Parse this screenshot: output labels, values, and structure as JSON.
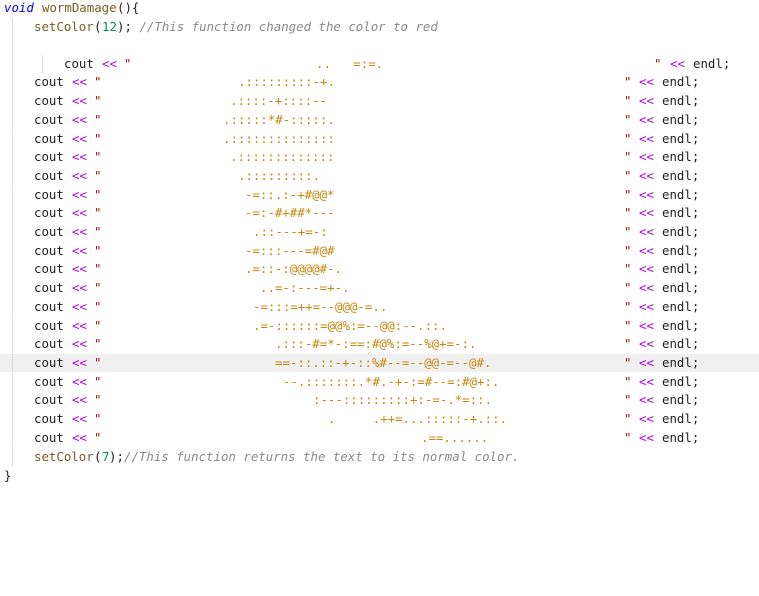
{
  "code": {
    "func_signature": {
      "keyword": "void",
      "name": "wormDamage",
      "rest": "(){"
    },
    "set_color_start": {
      "name": "setColor",
      "open": "(",
      "arg": "12",
      "close": ");",
      "comment": " //This function changed the color to red"
    },
    "first_cout": {
      "kw": "cout",
      "op": "<<",
      "quote_open": "\"",
      "art": "..   =:=.",
      "quote_close": "\"",
      "op2": "<<",
      "endl": "endl;"
    },
    "rows": [
      {
        "art": ".:::::::::-+."
      },
      {
        "art": ".::::-+::::--"
      },
      {
        "art": ".:::::*#-:::::."
      },
      {
        "art": ".::::::::::::::"
      },
      {
        "art": ".:::::::::::::"
      },
      {
        "art": ".:::::::::."
      },
      {
        "art": "-=::.:-+#@@*"
      },
      {
        "art": "-=:-#+##*---"
      },
      {
        "art": ".::---+=-:"
      },
      {
        "art": "-=:::---=#@#"
      },
      {
        "art": ".=::-:@@@@#-."
      },
      {
        "art": "..=-:---=+-."
      },
      {
        "art": "-=:::=++=--@@@-=.."
      },
      {
        "art": ".=-::::::=@@%:=--@@:--.::."
      },
      {
        "art": ".:::-#=*-:==:#@%:=--%@+=-:."
      },
      {
        "art": "==-::.::-+-::%#--=--@@-=--@#."
      },
      {
        "art": "--.:::::::.*#.-+-:=#--=:#@+:."
      },
      {
        "art": ":---:::::::::+:-=-.*=::."
      },
      {
        "art": ".     .++=...:::::-+.::."
      },
      {
        "art": ".==......"
      }
    ],
    "cout_kw": "cout",
    "op": "<<",
    "quote": "\"",
    "endl": "endl;",
    "set_color_end": {
      "name": "setColor",
      "open": "(",
      "arg": "7",
      "close": ");",
      "comment": "//This function returns the text to its normal color."
    },
    "closing_brace": "}"
  },
  "colors": {
    "keyword": "#0000ff",
    "function": "#795e26",
    "number": "#098658",
    "comment": "#8a8a8a",
    "operator": "#af00db",
    "string": "#a31515",
    "art": "#c8860d",
    "highlight_line": "#f0f0f0"
  }
}
